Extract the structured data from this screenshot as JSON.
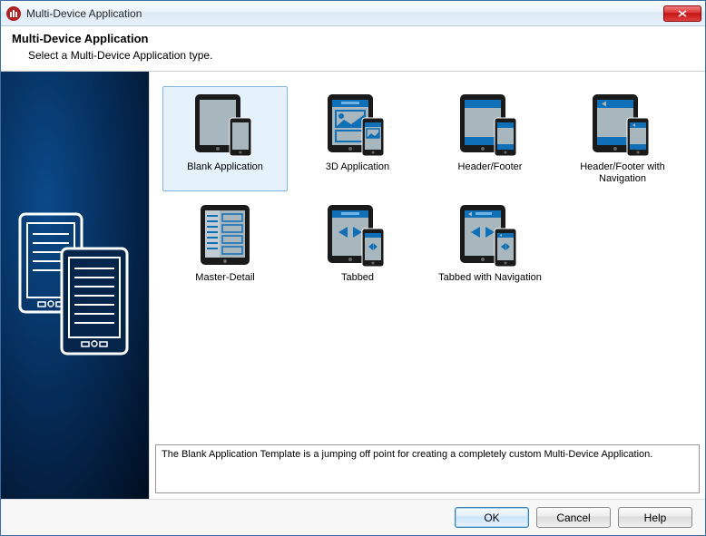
{
  "window": {
    "title": "Multi-Device Application"
  },
  "header": {
    "title": "Multi-Device Application",
    "subtitle": "Select a Multi-Device Application type."
  },
  "templates": [
    {
      "label": "Blank Application",
      "selected": true
    },
    {
      "label": "3D Application",
      "selected": false
    },
    {
      "label": "Header/Footer",
      "selected": false
    },
    {
      "label": "Header/Footer with Navigation",
      "selected": false
    },
    {
      "label": "Master-Detail",
      "selected": false
    },
    {
      "label": "Tabbed",
      "selected": false
    },
    {
      "label": "Tabbed with Navigation",
      "selected": false
    }
  ],
  "description": "The Blank Application Template is a jumping off point for creating a completely custom Multi-Device Application.",
  "buttons": {
    "ok": "OK",
    "cancel": "Cancel",
    "help": "Help"
  }
}
